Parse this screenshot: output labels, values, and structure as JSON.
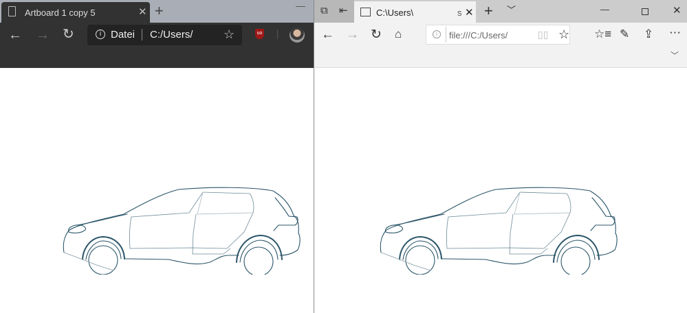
{
  "left_browser": {
    "tab_title": "Artboard 1 copy 5",
    "address_label": "Datei",
    "address_value": "C:/Users/",
    "icons": [
      "page-icon",
      "close-icon",
      "new-tab-icon",
      "back-icon",
      "forward-icon",
      "reload-icon",
      "info-icon",
      "favorite-add-icon",
      "ublock-icon",
      "avatar",
      "minimize-icon"
    ]
  },
  "right_browser": {
    "tab_title": "C:\\Users\\",
    "tab_truncated": "s",
    "address_value": "file:///C:/Users/",
    "icons": [
      "tab-preview-icon",
      "set-aside-icon",
      "page-icon",
      "close-icon",
      "new-tab-icon",
      "tab-list-chevron-icon",
      "minimize-icon",
      "maximize-icon",
      "window-close-icon",
      "back-icon",
      "forward-icon",
      "reload-icon",
      "home-icon",
      "info-icon",
      "reading-view-icon",
      "favorite-icon",
      "favorites-list-icon",
      "pen-icon",
      "share-icon",
      "more-icon",
      "expand-chevron-icon"
    ]
  },
  "colors": {
    "car_stroke": "#2a5468",
    "dark_chrome": "#323232",
    "light_chrome": "#f2f2f2"
  }
}
